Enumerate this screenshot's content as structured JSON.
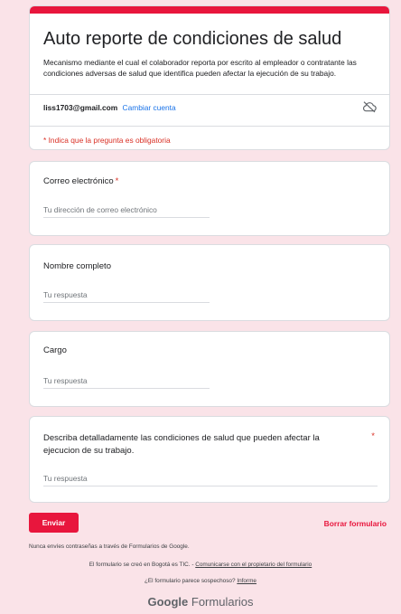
{
  "header": {
    "title": "Auto reporte de condiciones de salud",
    "description": "Mecanismo mediante el cual el colaborador reporta por escrito al empleador o contratante las condiciones adversas de salud que identifica pueden afectar la ejecución de su trabajo.",
    "account_email": "liss1703@gmail.com",
    "switch_account": "Cambiar cuenta",
    "cloud_icon": "cloud-off-icon",
    "required_note": "* Indica que la pregunta es obligatoria"
  },
  "questions": [
    {
      "label": "Correo electrónico",
      "required": "*",
      "placeholder": "Tu dirección de correo electrónico"
    },
    {
      "label": "Nombre completo",
      "placeholder": "Tu respuesta"
    },
    {
      "label": "Cargo",
      "placeholder": "Tu respuesta"
    },
    {
      "label": "Describa detalladamente las condiciones de salud que pueden afectar la ejecucion de su trabajo.",
      "required": "*",
      "placeholder": "Tu respuesta"
    }
  ],
  "actions": {
    "submit": "Enviar",
    "clear": "Borrar formulario"
  },
  "footer": {
    "warning": "Nunca envíes contraseñas a través de Formularios de Google.",
    "created_text": "El formulario se creó en Bogotá es TIC. - ",
    "contact_link": "Comunicarse con el propietario del formulario",
    "suspicious_text": "¿El formulario parece sospechoso? ",
    "report_link": "Informe",
    "logo_brand": "Google",
    "logo_product": "Formularios"
  },
  "colors": {
    "accent": "#e8163d",
    "background": "#fae3e8",
    "link": "#1a73e8",
    "required": "#d93025"
  }
}
